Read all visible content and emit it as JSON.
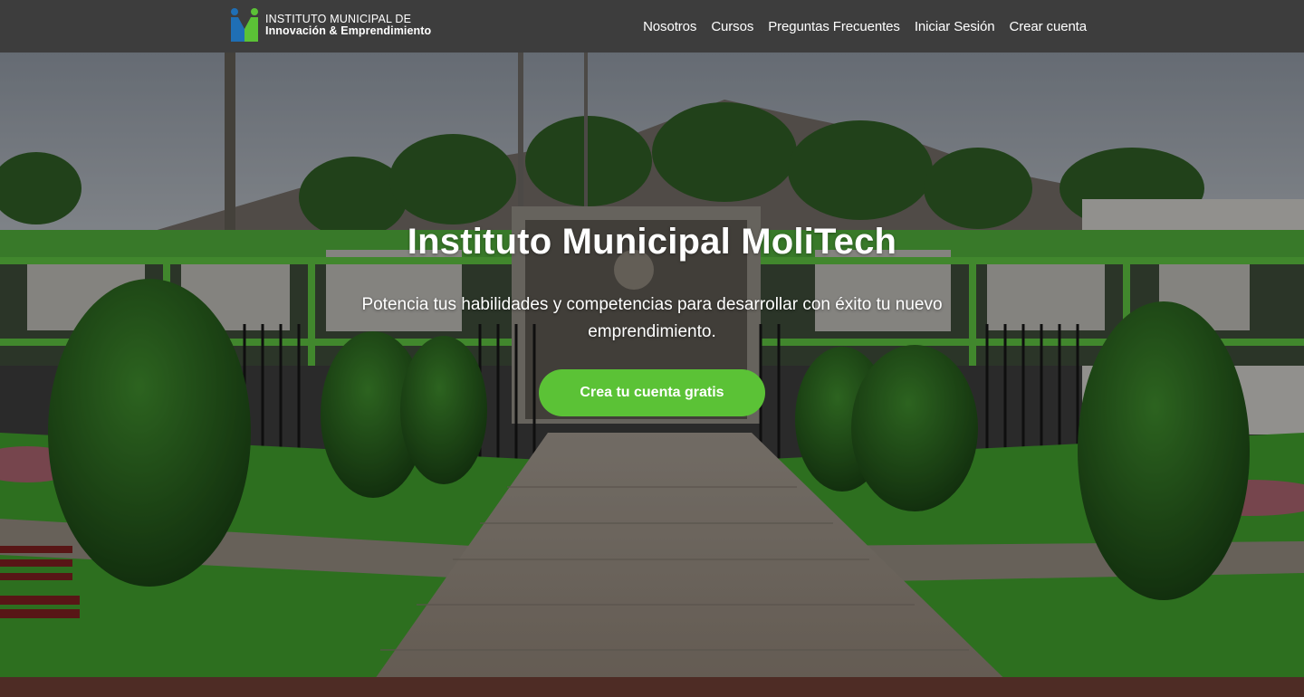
{
  "brand": {
    "line1": "INSTITUTO MUNICIPAL DE",
    "line2": "Innovación & Emprendimiento",
    "logo_icon": "mi-logo-icon",
    "colors": {
      "blue": "#1f6fb5",
      "green": "#5bc236"
    }
  },
  "nav": {
    "items": [
      {
        "label": "Nosotros"
      },
      {
        "label": "Cursos"
      },
      {
        "label": "Preguntas Frecuentes"
      },
      {
        "label": "Iniciar Sesión"
      },
      {
        "label": "Crear cuenta"
      }
    ]
  },
  "hero": {
    "title": "Instituto Municipal MoliTech",
    "subtitle": "Potencia tus habilidades y competencias para desarrollar con éxito tu nuevo emprendimiento.",
    "cta_label": "Crea tu cuenta gratis",
    "background": "campus-photo"
  },
  "colors": {
    "navbar_bg": "#3d3d3d",
    "accent": "#5bc236",
    "text": "#ffffff"
  }
}
